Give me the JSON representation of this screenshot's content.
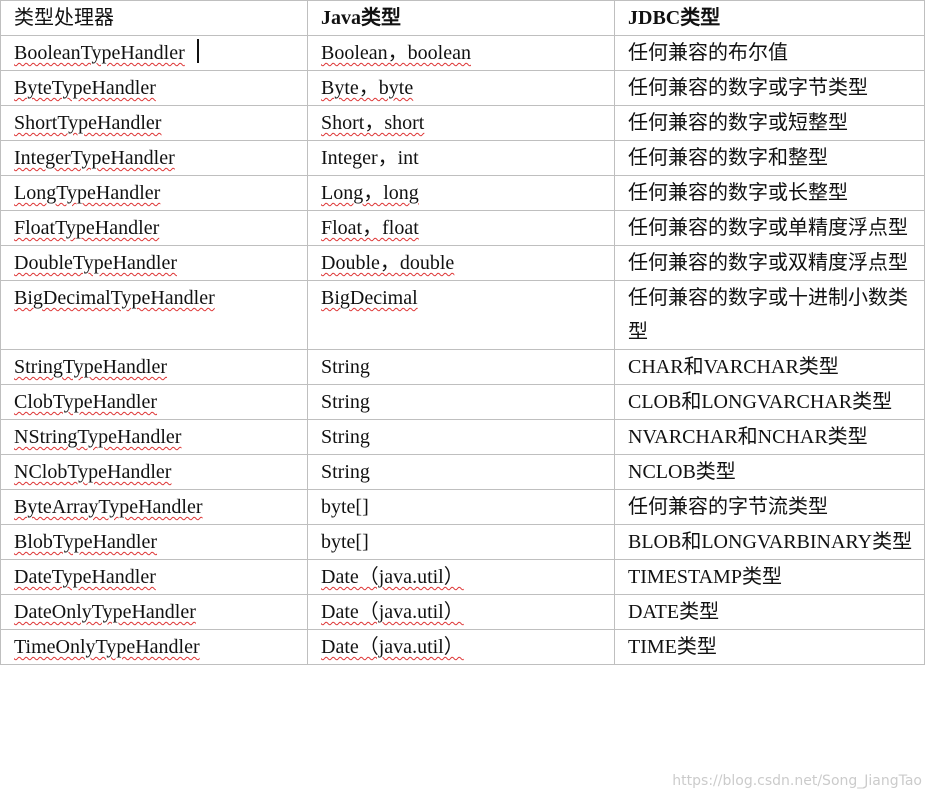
{
  "headers": {
    "handler": "类型处理器",
    "java": "Java类型",
    "jdbc": "JDBC类型"
  },
  "rows": [
    {
      "handler": "BooleanTypeHandler",
      "java": "Boolean，boolean",
      "jdbc": "任何兼容的布尔值"
    },
    {
      "handler": "ByteTypeHandler",
      "java": "Byte，byte",
      "jdbc": "任何兼容的数字或字节类型"
    },
    {
      "handler": "ShortTypeHandler",
      "java": "Short，short",
      "jdbc": "任何兼容的数字或短整型"
    },
    {
      "handler": "IntegerTypeHandler",
      "java": "Integer，int",
      "jdbc": "任何兼容的数字和整型"
    },
    {
      "handler": "LongTypeHandler",
      "java": "Long，long",
      "jdbc": "任何兼容的数字或长整型"
    },
    {
      "handler": "FloatTypeHandler",
      "java": "Float，float",
      "jdbc": "任何兼容的数字或单精度浮点型"
    },
    {
      "handler": "DoubleTypeHandler",
      "java": "Double，double",
      "jdbc": "任何兼容的数字或双精度浮点型"
    },
    {
      "handler": "BigDecimalTypeHandler",
      "java": "BigDecimal",
      "jdbc": "任何兼容的数字或十进制小数类型"
    },
    {
      "handler": "StringTypeHandler",
      "java": "String",
      "jdbc": "CHAR和VARCHAR类型"
    },
    {
      "handler": "ClobTypeHandler",
      "java": "String",
      "jdbc": "CLOB和LONGVARCHAR类型"
    },
    {
      "handler": "NStringTypeHandler",
      "java": "String",
      "jdbc": "NVARCHAR和NCHAR类型"
    },
    {
      "handler": "NClobTypeHandler",
      "java": "String",
      "jdbc": "NCLOB类型"
    },
    {
      "handler": "ByteArrayTypeHandler",
      "java": "byte[]",
      "jdbc": "任何兼容的字节流类型"
    },
    {
      "handler": "BlobTypeHandler",
      "java": "byte[]",
      "jdbc": "BLOB和LONGVARBINARY类型"
    },
    {
      "handler": "DateTypeHandler",
      "java": "Date（java.util）",
      "jdbc": "TIMESTAMP类型"
    },
    {
      "handler": "DateOnlyTypeHandler",
      "java": "Date（java.util）",
      "jdbc": "DATE类型"
    },
    {
      "handler": "TimeOnlyTypeHandler",
      "java": "Date（java.util）",
      "jdbc": "TIME类型"
    }
  ],
  "watermark": "https://blog.csdn.net/Song_JiangTao"
}
